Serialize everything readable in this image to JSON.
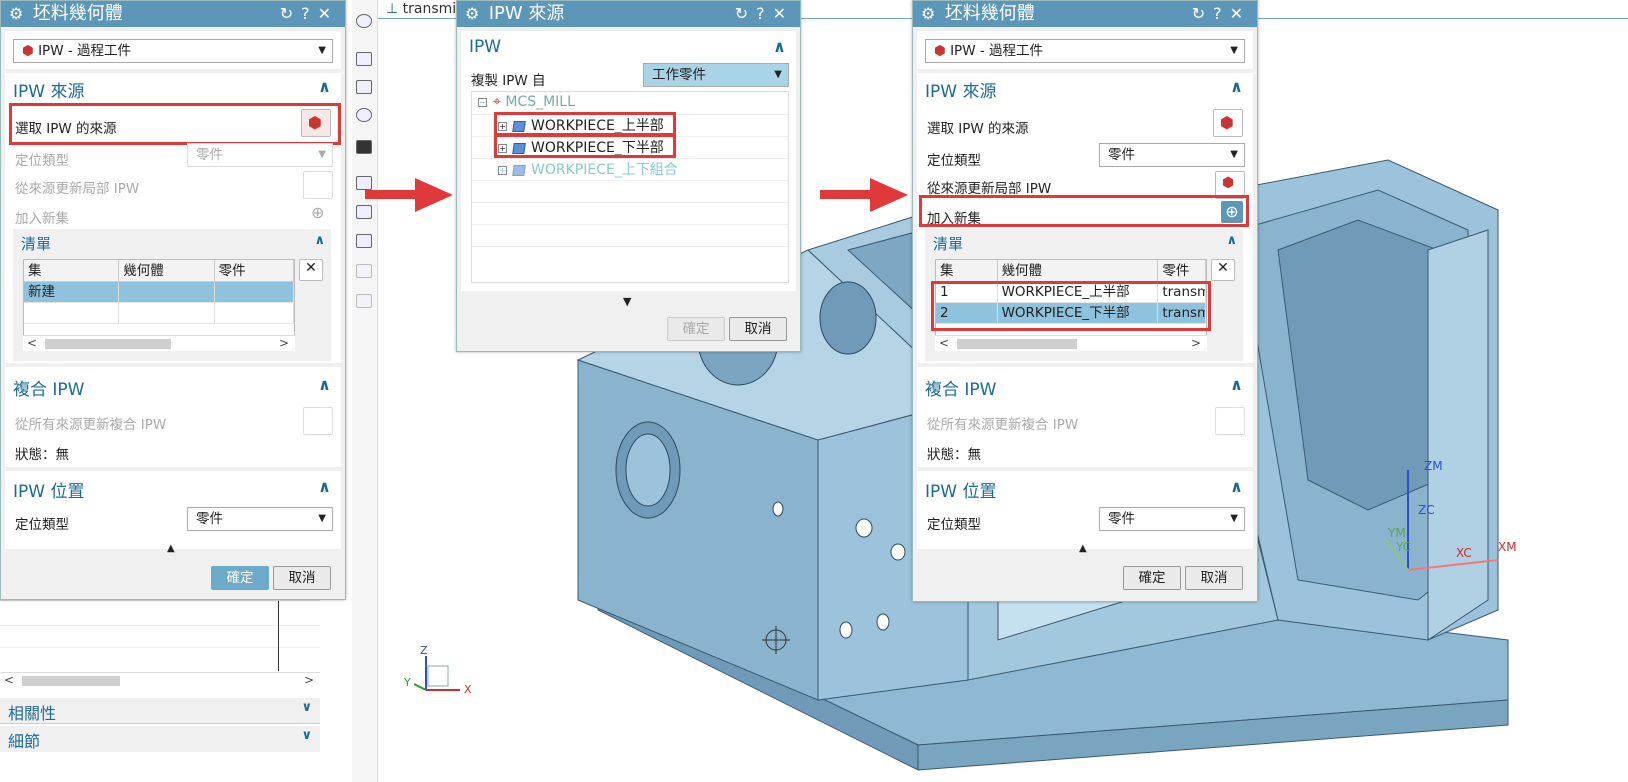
{
  "viewport": {
    "tab_title": "transmissi"
  },
  "dialog_left": {
    "title": "坯料幾何體",
    "type_value": "IPW - 過程工件",
    "source_section": "IPW 來源",
    "select_source": "選取 IPW 的來源",
    "locate_type": "定位類型",
    "locate_value": "零件",
    "update_local": "從來源更新局部 IPW",
    "add_set": "加入新集",
    "list_section": "清單",
    "list_cols": [
      "集",
      "幾何體",
      "零件"
    ],
    "list_row": "新建",
    "composite_section": "複合 IPW",
    "update_composite": "從所有來源更新複合 IPW",
    "status": "狀態：無",
    "position_section": "IPW 位置",
    "pos_locate_type": "定位類型",
    "pos_locate_value": "零件",
    "ok": "確定",
    "cancel": "取消"
  },
  "nav": {
    "related": "相關性",
    "details": "細節"
  },
  "dialog_mid": {
    "title": "IPW 來源",
    "section": "IPW",
    "copy_from": "複製 IPW 自",
    "copy_value": "工作零件",
    "tree_root": "MCS_MILL",
    "tree_items": [
      "WORKPIECE_上半部",
      "WORKPIECE_下半部",
      "WORKPIECE_上下組合"
    ],
    "ok": "確定",
    "cancel": "取消"
  },
  "dialog_right": {
    "title": "坯料幾何體",
    "type_value": "IPW - 過程工件",
    "source_section": "IPW 來源",
    "select_source": "選取 IPW 的來源",
    "locate_type": "定位類型",
    "locate_value": "零件",
    "update_local": "從來源更新局部 IPW",
    "add_set": "加入新集",
    "list_section": "清單",
    "list_cols": [
      "集",
      "幾何體",
      "零件"
    ],
    "rows": [
      {
        "set": "1",
        "geom": "WORKPIECE_上半部",
        "part": "transm"
      },
      {
        "set": "2",
        "geom": "WORKPIECE_下半部",
        "part": "transm"
      }
    ],
    "composite_section": "複合 IPW",
    "update_composite": "從所有來源更新複合 IPW",
    "status": "狀態：無",
    "position_section": "IPW 位置",
    "pos_locate_type": "定位類型",
    "pos_locate_value": "零件",
    "ok": "確定",
    "cancel": "取消"
  },
  "axes": {
    "zm": "ZM",
    "zc": "ZC",
    "ym": "YM",
    "yc": "YC",
    "xc": "XC",
    "xm": "XM",
    "z": "Z",
    "y": "Y",
    "x": "X"
  },
  "colors": {
    "titlebar": "#5c96b8",
    "highlight": "#e0393b",
    "selection": "#8fc2dc",
    "model": "#9cc3db"
  }
}
